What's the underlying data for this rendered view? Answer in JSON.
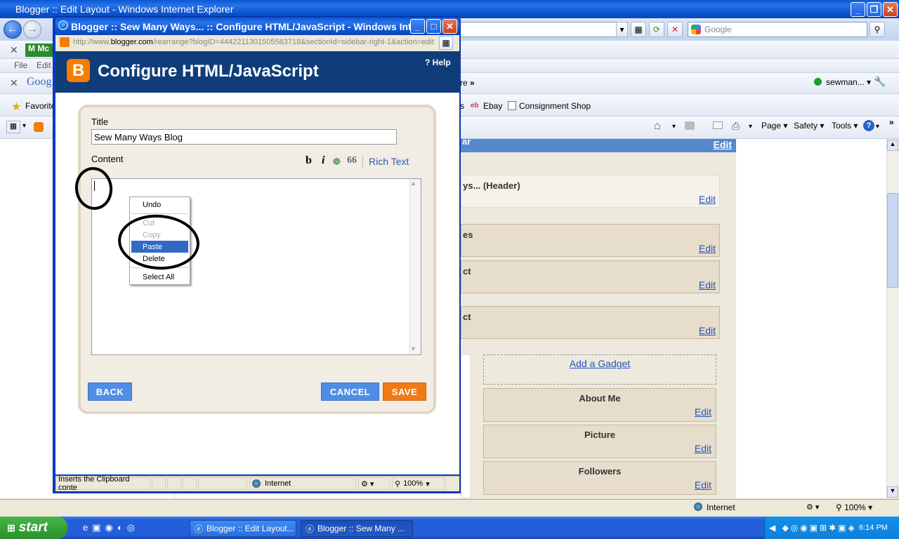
{
  "main_window": {
    "title": "Blogger :: Edit Layout - Windows Internet Explorer",
    "search_placeholder": "Google",
    "menu": {
      "file": "File",
      "edit": "Edit"
    },
    "links_bar": {
      "partial": "re",
      "ebay": "Ebay",
      "consignment": "Consignment Shop"
    },
    "user": "sewman...",
    "favorites": "Favorite",
    "toolbar": {
      "page": "Page",
      "safety": "Safety",
      "tools": "Tools"
    }
  },
  "layout": {
    "section_header": "ar",
    "section_edit": "Edit",
    "left_gadgets": [
      {
        "label": "ys... (Header)",
        "edit": "Edit"
      },
      {
        "label": "es",
        "edit": "Edit"
      },
      {
        "label": "ct",
        "edit": "Edit"
      },
      {
        "label": "ct",
        "edit": "Edit"
      }
    ],
    "add_gadget": "Add a Gadget",
    "right_gadgets": [
      {
        "label": "About Me",
        "edit": "Edit"
      },
      {
        "label": "Picture",
        "edit": "Edit"
      },
      {
        "label": "Followers",
        "edit": "Edit"
      }
    ]
  },
  "main_status": {
    "zone": "Internet",
    "zoom": "100%"
  },
  "popup": {
    "title": "Blogger :: Sew Many Ways... :: Configure HTML/JavaScript - Windows Inter...",
    "url_prefix": "http://www.",
    "url_domain": "blogger.com",
    "url_rest": "/rearrange?blogID=4442211301505583718&sectionId=sidebar-right-1&action=edit",
    "header_title": "Configure HTML/JavaScript",
    "help": "? Help",
    "title_label": "Title",
    "title_value": "Sew Many Ways Blog",
    "content_label": "Content",
    "format": {
      "bold": "b",
      "italic": "i",
      "quote": "66",
      "rich_text": "Rich Text"
    },
    "buttons": {
      "back": "BACK",
      "cancel": "CANCEL",
      "save": "SAVE"
    },
    "status_text": "Inserts the Clipboard conte",
    "zone": "Internet",
    "zoom": "100%"
  },
  "context_menu": {
    "undo": "Undo",
    "cut": "Cut",
    "copy": "Copy",
    "paste": "Paste",
    "delete": "Delete",
    "select_all": "Select All"
  },
  "taskbar": {
    "start": "start",
    "tasks": [
      "Blogger :: Edit Layout...",
      "Blogger :: Sew Many ..."
    ],
    "clock": "6:14 PM"
  }
}
